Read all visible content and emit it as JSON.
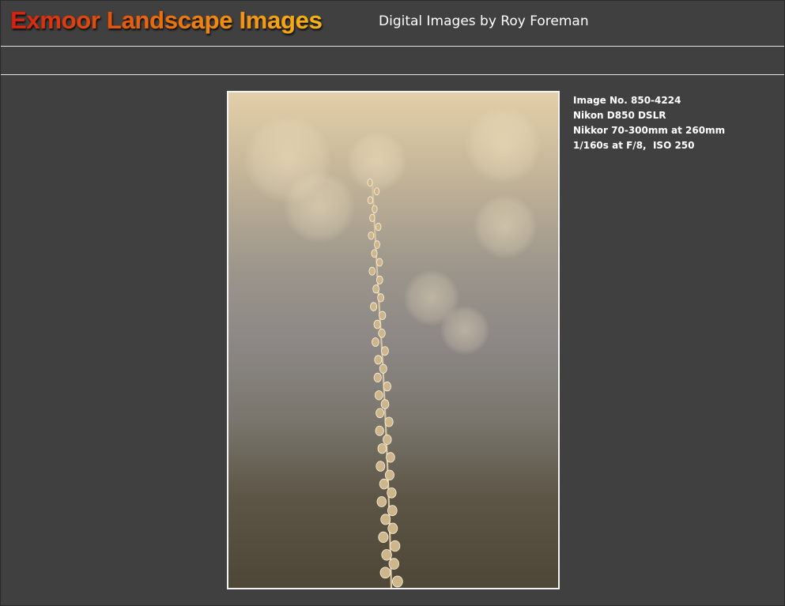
{
  "header": {
    "title": "Exmoor Landscape Images",
    "subtitle": "Digital Images by Roy Foreman"
  },
  "photo": {
    "image_number": "Image No. 850-4224",
    "camera": "Nikon D850 DSLR",
    "lens": "Nikkor 70-300mm at 260mm",
    "exposure": "1/160s at F/8,  ISO 250"
  },
  "colors": {
    "page_background": "#404040",
    "title_gradient_start": "#d42010",
    "title_gradient_end": "#f6b418",
    "rule_color": "#e6e6e6",
    "text_color": "#ffffff"
  }
}
